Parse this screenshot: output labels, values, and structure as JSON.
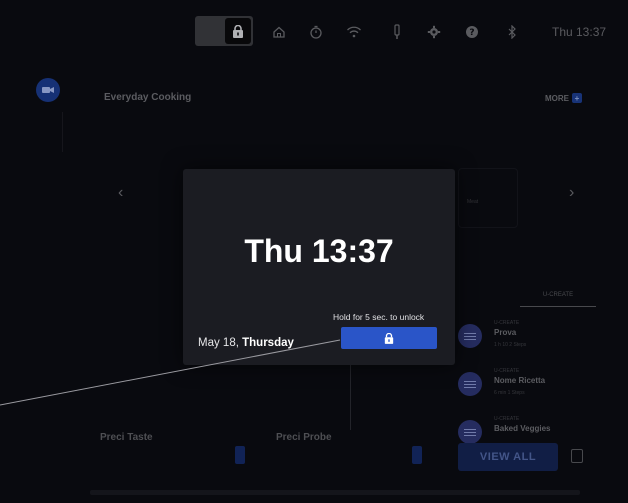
{
  "topbar": {
    "clock": "Thu 13:37",
    "icons": [
      "lock-icon",
      "home-icon",
      "timer-icon",
      "wifi-icon",
      "probe-icon",
      "gear-icon",
      "help-icon",
      "bluetooth-icon"
    ]
  },
  "background": {
    "section_title": "Everyday Cooking",
    "more_label": "MORE",
    "card_label": "Meat",
    "ucreate_tab": "U-CREATE",
    "recipes": [
      {
        "category": "U-CREATE",
        "name": "Prova",
        "meta": "1 h 10   2 Steps"
      },
      {
        "category": "U-CREATE",
        "name": "Nome Ricetta",
        "meta": "6 min   1 Steps"
      },
      {
        "category": "U-CREATE",
        "name": "Baked Veggies",
        "meta": ""
      }
    ],
    "view_all_label": "VIEW ALL",
    "precitaste_title": "Preci Taste",
    "preciprobe_title": "Preci Probe"
  },
  "lock_modal": {
    "time": "Thu 13:37",
    "date_prefix": "May 18,",
    "date_day": "Thursday",
    "hold_hint": "Hold for 5 sec. to unlock"
  },
  "colors": {
    "accent": "#2a55c8",
    "modal_bg": "#1b1c22",
    "screen_bg": "#0b0c12"
  }
}
